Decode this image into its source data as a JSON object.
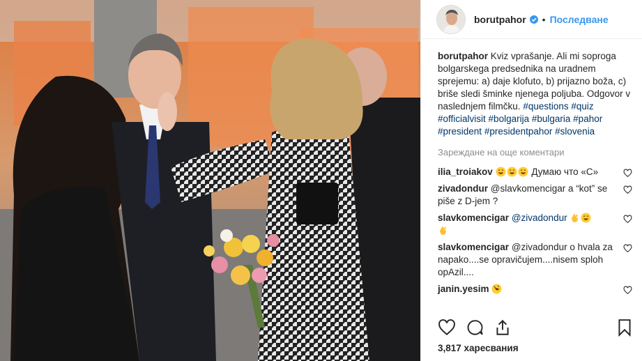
{
  "post": {
    "username": "borutpahor",
    "follow_label": "Последване",
    "dot": "•",
    "caption": "Kviz vprašanje. Ali mi soproga bolgarskega predsednika na uradnem sprejemu: a) daje klofuto, b) prijazno boža, c) briše sledi šminke njenega poljuba. Odgovor v naslednjem filmčku.",
    "hashtags": [
      "#questions",
      "#quiz",
      "#officialvisit",
      "#bolgarija",
      "#bulgaria",
      "#pahor",
      "#president",
      "#presidentpahor",
      "#slovenia"
    ],
    "load_more": "Зареждане на още коментари",
    "comments": [
      {
        "user": "ilia_troiakov",
        "text": "Думаю что «С»",
        "emoji_before": 3,
        "emoji_after": 0,
        "emoji_kind": "laugh"
      },
      {
        "user": "zivadondur",
        "text": "@slavkomencigar a “kot” se piše z D-jem ?",
        "emoji_before": 0,
        "emoji_after": 0,
        "emoji_kind": ""
      },
      {
        "user": "slavkomencigar",
        "text": "@zivadondur",
        "emoji_before": 0,
        "emoji_after": 3,
        "emoji_kind": "clap-laugh-clap"
      },
      {
        "user": "slavkomencigar",
        "text": "@zivadondur o hvala za napako....se opravičujem....nisem sploh opAzil....",
        "emoji_before": 0,
        "emoji_after": 0,
        "emoji_kind": ""
      },
      {
        "user": "janin.yesim",
        "text": "",
        "emoji_before": 0,
        "emoji_after": 1,
        "emoji_kind": "rofl"
      }
    ],
    "likes": "3,817 харесвания"
  },
  "icons": {
    "verified": "verified-badge-icon",
    "like": "heart-outline-icon",
    "comment": "speech-bubble-icon",
    "share": "share-upload-icon",
    "save": "bookmark-icon",
    "comment_like": "small-heart-icon"
  },
  "colors": {
    "link": "#3897f0",
    "hashtag": "#003569",
    "muted": "#8e8e8e",
    "verified": "#3897f0"
  }
}
